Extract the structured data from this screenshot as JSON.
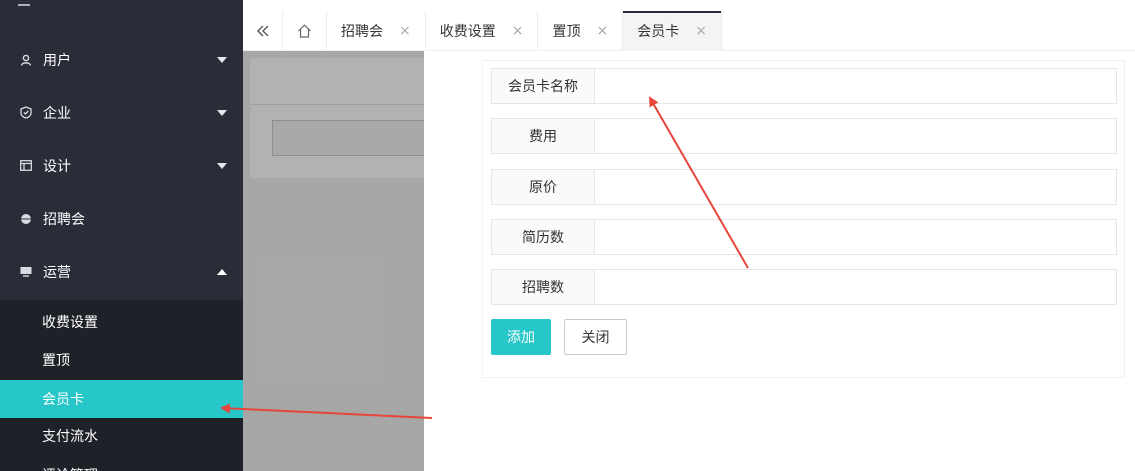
{
  "sidebar": {
    "items": [
      {
        "label": "用户",
        "icon": "user-icon",
        "expanded": false
      },
      {
        "label": "企业",
        "icon": "shield-icon",
        "expanded": false
      },
      {
        "label": "设计",
        "icon": "layout-icon",
        "expanded": false
      },
      {
        "label": "招聘会",
        "icon": "dot-icon",
        "expanded": null
      },
      {
        "label": "运营",
        "icon": "monitor-icon",
        "expanded": true
      }
    ],
    "sub_items": [
      {
        "label": "收费设置",
        "active": false
      },
      {
        "label": "置顶",
        "active": false
      },
      {
        "label": "会员卡",
        "active": true
      },
      {
        "label": "支付流水",
        "active": false
      },
      {
        "label": "评论管理",
        "active": false
      }
    ]
  },
  "tabs": [
    {
      "label": "招聘会",
      "active": false
    },
    {
      "label": "收费设置",
      "active": false
    },
    {
      "label": "置顶",
      "active": false
    },
    {
      "label": "会员卡",
      "active": true
    }
  ],
  "tab_close_glyph": "×",
  "form": {
    "fields": [
      {
        "label": "会员卡名称",
        "value": "",
        "placeholder": ""
      },
      {
        "label": "费用",
        "value": "",
        "placeholder": ""
      },
      {
        "label": "原价",
        "value": "",
        "placeholder": ""
      },
      {
        "label": "简历数",
        "value": "",
        "placeholder": ""
      },
      {
        "label": "招聘数",
        "value": "",
        "placeholder": ""
      }
    ],
    "add_label": "添加",
    "close_label": "关闭"
  },
  "colors": {
    "sidebar_bg": "#2a2d38",
    "submenu_bg": "#1f2128",
    "accent": "#26c6c9",
    "annotation_arrow": "#e8453c"
  }
}
